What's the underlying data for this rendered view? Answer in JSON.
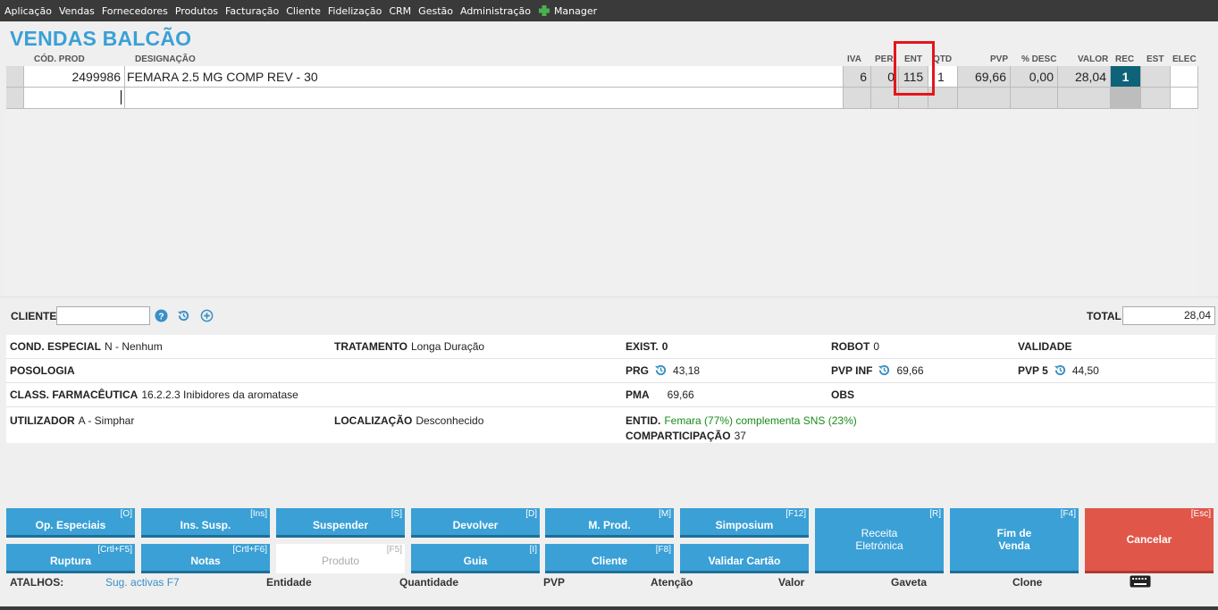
{
  "menu": [
    "Aplicação",
    "Vendas",
    "Fornecedores",
    "Produtos",
    "Facturação",
    "Cliente",
    "Fidelização",
    "CRM",
    "Gestão",
    "Administração",
    "Manager"
  ],
  "title": "VENDAS BALCÃO",
  "columns": {
    "cod": "CÓD. PROD",
    "desig": "DESIGNAÇÃO",
    "iva": "IVA",
    "per": "PER",
    "ent": "ENT",
    "qtd": "QTD",
    "pvp": "PVP",
    "desc": "% DESC",
    "valor": "VALOR",
    "rec": "REC",
    "est": "EST",
    "elec": "ELEC"
  },
  "row": {
    "cod": "2499986",
    "desig": "FEMARA 2.5 MG COMP REV     - 30",
    "iva": "6",
    "per": "0",
    "ent": "115",
    "qtd": "1",
    "pvp": "69,66",
    "desc": "0,00",
    "valor": "28,04",
    "rec": "1"
  },
  "client": {
    "label": "CLIENTE",
    "value": ""
  },
  "total": {
    "label": "TOTAL",
    "value": "28,04"
  },
  "info": {
    "cond_label": "COND. ESPECIAL",
    "cond_value": "N - Nenhum",
    "trat_label": "TRATAMENTO",
    "trat_value": "Longa Duração",
    "exist_label": "EXIST.",
    "exist_value": "0",
    "robot_label": "ROBOT",
    "robot_value": "0",
    "valid_label": "VALIDADE",
    "poso_label": "POSOLOGIA",
    "prg_label": "PRG",
    "prg_value": "43,18",
    "pvpinf_label": "PVP INF",
    "pvpinf_value": "69,66",
    "pvp5_label": "PVP 5",
    "pvp5_value": "44,50",
    "class_label": "CLASS. FARMACÊUTICA",
    "class_value": "16.2.2.3 Inibidores da aromatase",
    "pma_label": "PMA",
    "pma_value": "69,66",
    "obs_label": "OBS",
    "util_label": "UTILIZADOR",
    "util_value": "A - Simphar",
    "loc_label": "LOCALIZAÇÃO",
    "loc_value": "Desconhecido",
    "entid_label": "ENTID.",
    "entid_value": "Femara (77%) complementa SNS (23%)",
    "comp_label": "COMPARTICIPAÇÃO",
    "comp_value": "37"
  },
  "buttons": {
    "op": {
      "label": "Op. Especiais",
      "key": "[O]"
    },
    "ins": {
      "label": "Ins. Susp.",
      "key": "[Ins]"
    },
    "susp": {
      "label": "Suspender",
      "key": "[S]"
    },
    "dev": {
      "label": "Devolver",
      "key": "[D]"
    },
    "mprod": {
      "label": "M. Prod.",
      "key": "[M]"
    },
    "simp": {
      "label": "Simposium",
      "key": "[F12]"
    },
    "receita1": "Receita",
    "receita2": "Eletrónica",
    "receita_key": "[R]",
    "fim1": "Fim de",
    "fim2": "Venda",
    "fim_key": "[F4]",
    "cancel": {
      "label": "Cancelar",
      "key": "[Esc]"
    },
    "rupt": {
      "label": "Ruptura",
      "key": "[Crtl+F5]"
    },
    "notas": {
      "label": "Notas",
      "key": "[Crtl+F6]"
    },
    "produto": {
      "label": "Produto",
      "key": "[F5]"
    },
    "guia": {
      "label": "Guia",
      "key": "[I]"
    },
    "cliente": {
      "label": "Cliente",
      "key": "[F8]"
    },
    "validar": {
      "label": "Validar Cartão"
    }
  },
  "shortcuts": {
    "label": "ATALHOS:",
    "sug": "Sug. activas F7",
    "entidade": "Entidade",
    "quantidade": "Quantidade",
    "pvp": "PVP",
    "atencao": "Atenção",
    "valor": "Valor",
    "gaveta": "Gaveta",
    "clone": "Clone"
  },
  "colors": {
    "accent": "#3aa0d6",
    "rec": "#0e6378",
    "cancel": "#e0574a",
    "highlight": "#e3161b",
    "green": "#1a8a1a"
  }
}
